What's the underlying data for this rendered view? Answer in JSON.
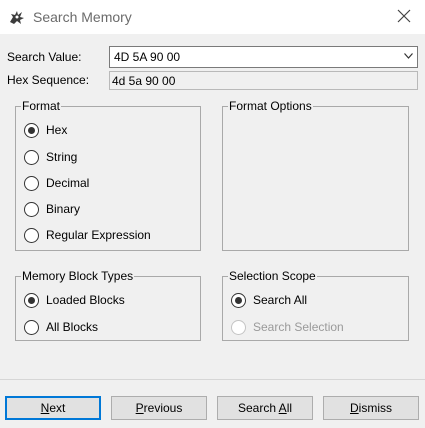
{
  "window": {
    "title": "Search Memory",
    "icon": "dragon-icon",
    "close_icon": "close-icon"
  },
  "search": {
    "value_label": "Search Value:",
    "value": "4D 5A 90 00",
    "hex_label": "Hex Sequence:",
    "hex_value": "4d 5a 90 00"
  },
  "format": {
    "title": "Format",
    "options": [
      {
        "label": "Hex",
        "checked": true
      },
      {
        "label": "String",
        "checked": false
      },
      {
        "label": "Decimal",
        "checked": false
      },
      {
        "label": "Binary",
        "checked": false
      },
      {
        "label": "Regular Expression",
        "checked": false
      }
    ]
  },
  "format_options": {
    "title": "Format Options"
  },
  "memory_blocks": {
    "title": "Memory Block Types",
    "options": [
      {
        "label": "Loaded Blocks",
        "checked": true
      },
      {
        "label": "All Blocks",
        "checked": false
      }
    ]
  },
  "selection_scope": {
    "title": "Selection Scope",
    "options": [
      {
        "label": "Search All",
        "checked": true,
        "enabled": true
      },
      {
        "label": "Search Selection",
        "checked": false,
        "enabled": false
      }
    ]
  },
  "buttons": {
    "next": {
      "first": "N",
      "rest": "ext"
    },
    "previous": {
      "first": "P",
      "rest": "revious"
    },
    "search_all": {
      "before": "Search ",
      "mnemonic": "A",
      "after": "ll"
    },
    "dismiss": {
      "first": "D",
      "rest": "ismiss"
    }
  },
  "colors": {
    "background": "#f0f0f0",
    "default_button_border": "#0078d7"
  }
}
